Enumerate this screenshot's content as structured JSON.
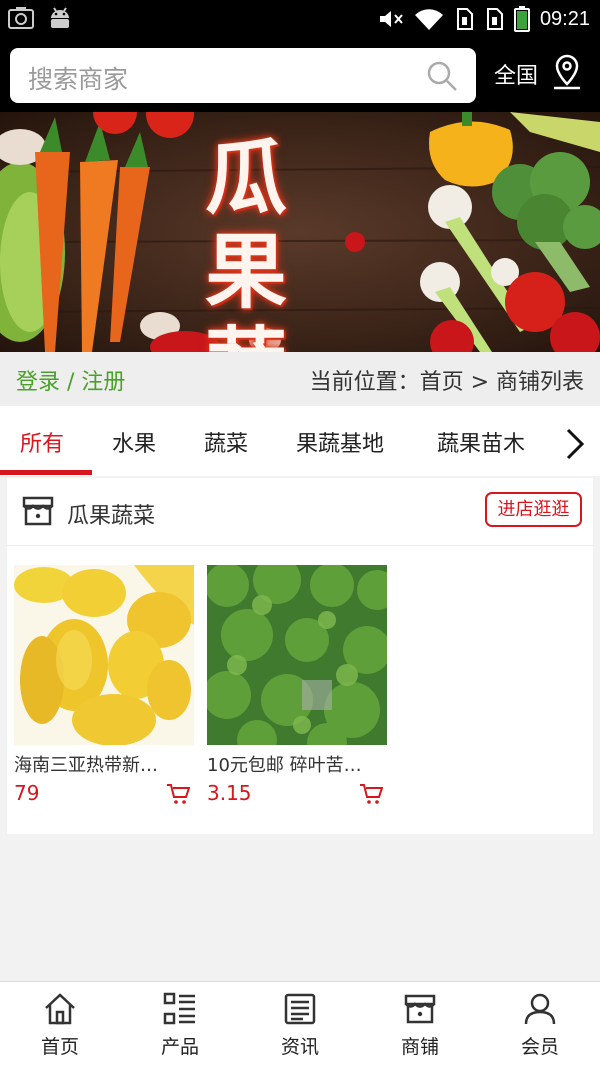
{
  "status_bar": {
    "time": "09:21"
  },
  "search": {
    "placeholder": "搜索商家"
  },
  "region": {
    "label": "全国"
  },
  "banner": {
    "line1": "瓜 果",
    "line2": "蔬 菜"
  },
  "auth": {
    "text": "登录 / 注册"
  },
  "breadcrumb": {
    "text": "当前位置：首页 > 商铺列表"
  },
  "tabs": [
    {
      "label": "所有",
      "active": true
    },
    {
      "label": "水果"
    },
    {
      "label": "蔬菜"
    },
    {
      "label": "果蔬基地"
    },
    {
      "label": "蔬果苗木"
    }
  ],
  "shop": {
    "name": "瓜果蔬菜",
    "visit_label": "进店逛逛",
    "products": [
      {
        "name": "海南三亚热带新…",
        "price": "79"
      },
      {
        "name": "10元包邮 碎叶苦…",
        "price": "3.15"
      }
    ]
  },
  "bottom_nav": [
    {
      "label": "首页",
      "icon": "home-icon"
    },
    {
      "label": "产品",
      "icon": "list-icon"
    },
    {
      "label": "资讯",
      "icon": "news-icon"
    },
    {
      "label": "商铺",
      "icon": "store-icon"
    },
    {
      "label": "会员",
      "icon": "user-icon"
    }
  ],
  "colors": {
    "accent": "#d9161d",
    "login_green": "#4aa12a",
    "header": "#000000"
  }
}
